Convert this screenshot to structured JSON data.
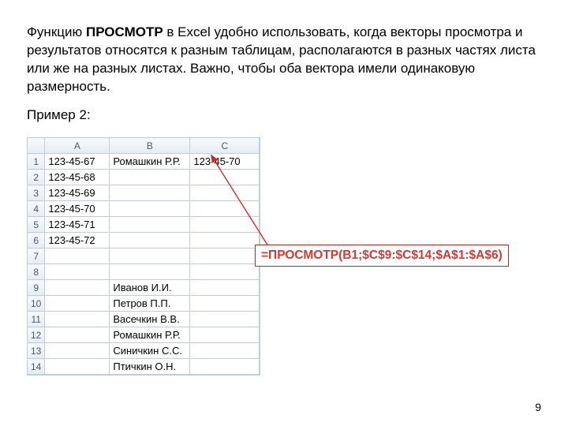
{
  "paragraph_prefix": "Функцию ",
  "paragraph_strong": "ПРОСМОТР",
  "paragraph_suffix": " в Excel удобно использовать, когда векторы просмотра и результатов относятся к разным таблицам, располагаются в разных частях листа или же на разных листах. Важно, чтобы оба вектора имели одинаковую размерность.",
  "example_label": "Пример 2:",
  "sheet": {
    "columns": [
      "A",
      "B",
      "C"
    ],
    "rows": [
      {
        "n": "1",
        "A": "123-45-67",
        "B": "Ромашкин Р.Р.",
        "C": "123-45-70"
      },
      {
        "n": "2",
        "A": "123-45-68",
        "B": "",
        "C": ""
      },
      {
        "n": "3",
        "A": "123-45-69",
        "B": "",
        "C": ""
      },
      {
        "n": "4",
        "A": "123-45-70",
        "B": "",
        "C": ""
      },
      {
        "n": "5",
        "A": "123-45-71",
        "B": "",
        "C": ""
      },
      {
        "n": "6",
        "A": "123-45-72",
        "B": "",
        "C": ""
      },
      {
        "n": "7",
        "A": "",
        "B": "",
        "C": ""
      },
      {
        "n": "8",
        "A": "",
        "B": "",
        "C": ""
      },
      {
        "n": "9",
        "A": "",
        "B": "Иванов И.И.",
        "C": ""
      },
      {
        "n": "10",
        "A": "",
        "B": "Петров П.П.",
        "C": ""
      },
      {
        "n": "11",
        "A": "",
        "B": "Васечкин В.В.",
        "C": ""
      },
      {
        "n": "12",
        "A": "",
        "B": "Ромашкин Р.Р.",
        "C": ""
      },
      {
        "n": "13",
        "A": "",
        "B": "Синичкин С.С.",
        "C": ""
      },
      {
        "n": "14",
        "A": "",
        "B": "Птичкин О.Н.",
        "C": ""
      }
    ]
  },
  "formula": "=ПРОСМОТР(B1;$C$9:$C$14;$A$1:$A$6)",
  "page_number": "9"
}
